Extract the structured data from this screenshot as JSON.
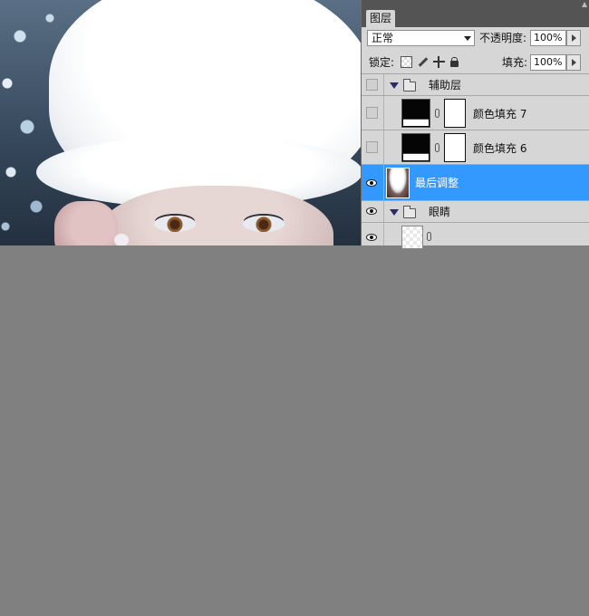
{
  "panel": {
    "tab_label": "图层",
    "blend_mode": "正常",
    "opacity_label": "不透明度:",
    "opacity_value": "100%",
    "lock_label": "锁定:",
    "fill_label": "填充:",
    "fill_value": "100%"
  },
  "layers": [
    {
      "name": "辅助层",
      "kind": "group",
      "visible": false,
      "expanded": true
    },
    {
      "name": "颜色填充 7",
      "kind": "fill",
      "visible": false
    },
    {
      "name": "颜色填充 6",
      "kind": "fill",
      "visible": false
    },
    {
      "name": "最后调整",
      "kind": "image",
      "visible": true,
      "selected": true
    },
    {
      "name": "眼睛",
      "kind": "group",
      "visible": true,
      "expanded": true
    },
    {
      "name": "",
      "kind": "image",
      "visible": true
    }
  ],
  "colors": {
    "selected_row": "#3399ff",
    "panel_bg": "#d6d6d6",
    "workspace_bg": "#808080",
    "tabbar_bg": "#545454"
  }
}
